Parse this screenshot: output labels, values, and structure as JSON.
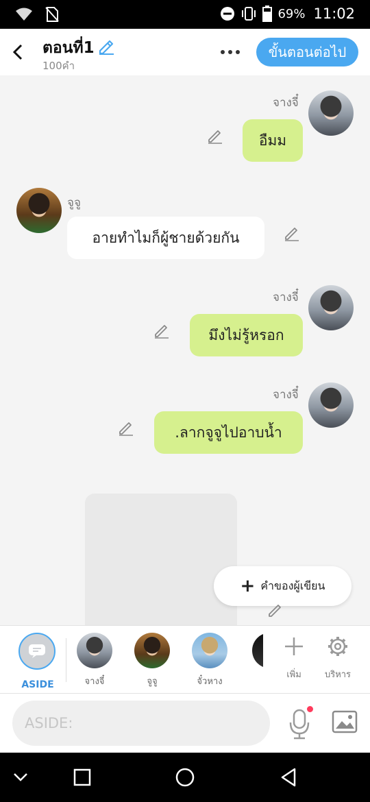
{
  "status_bar": {
    "battery": "69%",
    "time": "11:02"
  },
  "header": {
    "title": "ตอนที่1",
    "word_count": "100คำ",
    "next_button": "ขั้นตอนต่อไป"
  },
  "messages": [
    {
      "sender": "จางจี๋",
      "text": "อืมม",
      "side": "right"
    },
    {
      "sender": "จูจู",
      "text": "อายทำไมก็ผู้ชายด้วยกัน",
      "side": "left"
    },
    {
      "sender": "จางจี๋",
      "text": "มึงไม่รู้หรอก",
      "side": "right"
    },
    {
      "sender": "จางจี๋",
      "text": ".ลากจูจูไปอาบน้ำ",
      "side": "right"
    }
  ],
  "author_button": {
    "label": "คำของผู้เขียน"
  },
  "character_bar": {
    "aside_label": "ASIDE",
    "characters": [
      {
        "name": "จางจี๋"
      },
      {
        "name": "จูจู"
      },
      {
        "name": "จั๋วหาง"
      }
    ],
    "add_label": "เพิ่ม",
    "manage_label": "บริหาร"
  },
  "input": {
    "placeholder": "ASIDE:"
  },
  "colors": {
    "accent": "#4aa8f0",
    "my_bubble": "#d6f08e",
    "other_bubble": "#ffffff",
    "notification_dot": "#ff3b5c"
  }
}
